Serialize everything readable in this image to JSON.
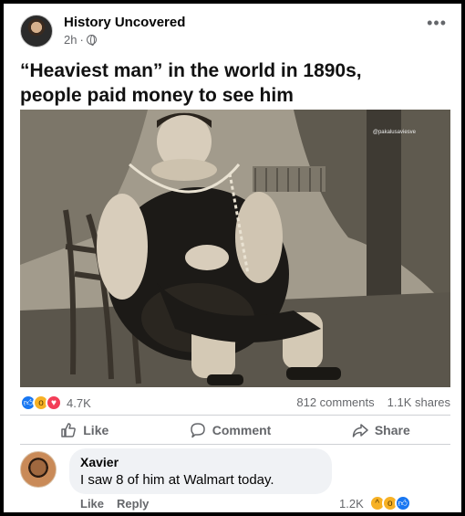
{
  "post": {
    "page_name": "History Uncovered",
    "time": "2h",
    "more_label": "•••",
    "caption_line1": "“Heaviest man”  in the world in 1890s,",
    "caption_line2": "people paid money to see him",
    "photo_watermark": "@pakalusaviesve",
    "reactions_count": "4.7K",
    "comments_count": "812 comments",
    "shares_count": "1.1K shares"
  },
  "actions": {
    "like": "Like",
    "comment": "Comment",
    "share": "Share"
  },
  "comment": {
    "author": "Xavier",
    "text": "I saw 8 of him at Walmart today.",
    "like": "Like",
    "reply": "Reply",
    "reactions_count": "1.2K"
  },
  "colors": {
    "like_blue": "#1877f2",
    "love_red": "#f33e58",
    "wow_yellow": "#f7b125",
    "secondary_text": "#65676b"
  }
}
